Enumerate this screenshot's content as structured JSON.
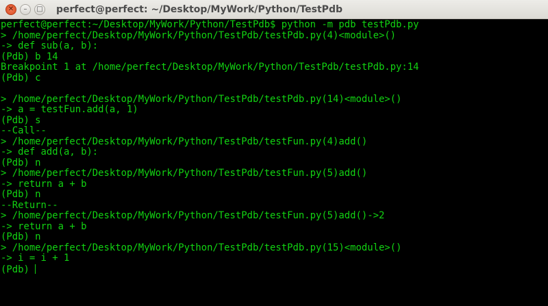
{
  "window": {
    "title": "perfect@perfect: ~/Desktop/MyWork/Python/TestPdb",
    "text_color": "#12d312",
    "background": "#000000"
  },
  "terminal": {
    "lines": [
      "perfect@perfect:~/Desktop/MyWork/Python/TestPdb$ python -m pdb testPdb.py",
      "> /home/perfect/Desktop/MyWork/Python/TestPdb/testPdb.py(4)<module>()",
      "-> def sub(a, b):",
      "(Pdb) b 14",
      "Breakpoint 1 at /home/perfect/Desktop/MyWork/Python/TestPdb/testPdb.py:14",
      "(Pdb) c",
      "",
      "> /home/perfect/Desktop/MyWork/Python/TestPdb/testPdb.py(14)<module>()",
      "-> a = testFun.add(a, 1)",
      "(Pdb) s",
      "--Call--",
      "> /home/perfect/Desktop/MyWork/Python/TestPdb/testFun.py(4)add()",
      "-> def add(a, b):",
      "(Pdb) n",
      "> /home/perfect/Desktop/MyWork/Python/TestPdb/testFun.py(5)add()",
      "-> return a + b",
      "(Pdb) n",
      "--Return--",
      "> /home/perfect/Desktop/MyWork/Python/TestPdb/testFun.py(5)add()->2",
      "-> return a + b",
      "(Pdb) n",
      "> /home/perfect/Desktop/MyWork/Python/TestPdb/testPdb.py(15)<module>()",
      "-> i = i + 1"
    ],
    "prompt": "(Pdb) "
  }
}
